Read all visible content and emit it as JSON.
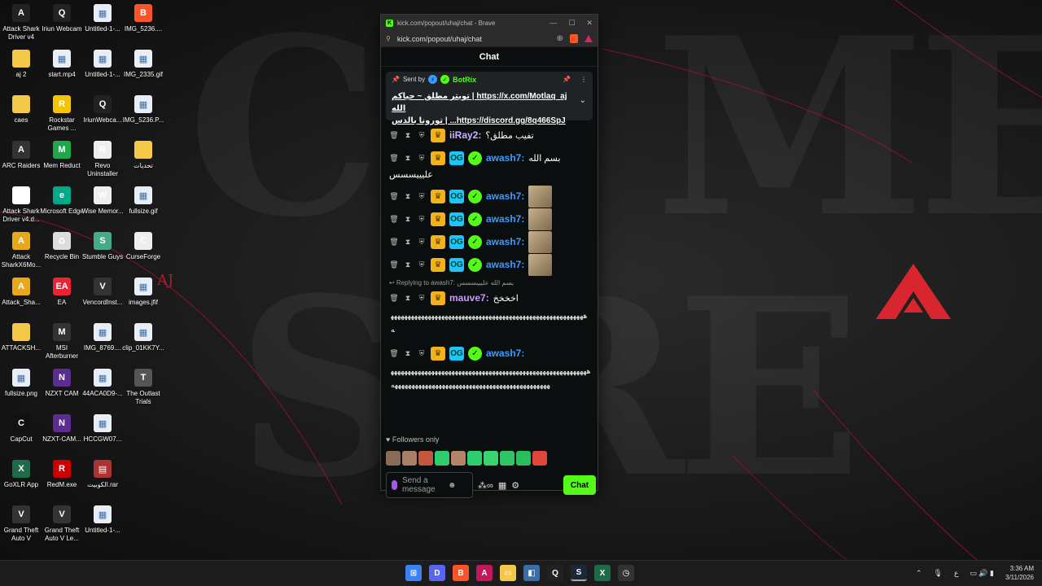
{
  "desktop": {
    "icons": [
      {
        "label": "Attack Shark Driver v4",
        "glyph": "A"
      },
      {
        "label": "Iriun Webcam",
        "glyph": "Q"
      },
      {
        "label": "Untitled-1-...",
        "glyph": "▦"
      },
      {
        "label": "IMG_5236....",
        "glyph": "B"
      },
      {
        "label": "aj 2",
        "glyph": ""
      },
      {
        "label": "start.mp4",
        "glyph": "▦"
      },
      {
        "label": "Untitled-1-...",
        "glyph": "▦"
      },
      {
        "label": "IMG_2335.gif",
        "glyph": "▦"
      },
      {
        "label": "caes",
        "glyph": ""
      },
      {
        "label": "Rockstar Games ...",
        "glyph": "R"
      },
      {
        "label": "IriunWebca...",
        "glyph": "Q"
      },
      {
        "label": "IMG_5236.P...",
        "glyph": "▦"
      },
      {
        "label": "ARC Raiders",
        "glyph": "A"
      },
      {
        "label": "Mem Reduct",
        "glyph": "M"
      },
      {
        "label": "Revo Uninstaller",
        "glyph": "R"
      },
      {
        "label": "تحديات",
        "glyph": ""
      },
      {
        "label": "Attack Shark Driver v4.d...",
        "glyph": "▯"
      },
      {
        "label": "Microsoft Edge",
        "glyph": "e"
      },
      {
        "label": "Wise Memor...",
        "glyph": "W"
      },
      {
        "label": "fullsize.gif",
        "glyph": "▦"
      },
      {
        "label": "Attack SharkX6Mo...",
        "glyph": "A"
      },
      {
        "label": "Recycle Bin",
        "glyph": "♻"
      },
      {
        "label": "Stumble Guys",
        "glyph": "S"
      },
      {
        "label": "CurseForge",
        "glyph": "C"
      },
      {
        "label": "Attack_Sha...",
        "glyph": "A"
      },
      {
        "label": "EA",
        "glyph": "EA"
      },
      {
        "label": "VencordInst...",
        "glyph": "V"
      },
      {
        "label": "images.jfif",
        "glyph": "▦"
      },
      {
        "label": "ATTACKSH...",
        "glyph": ""
      },
      {
        "label": "MSI Afterburner",
        "glyph": "M"
      },
      {
        "label": "IMG_8769....",
        "glyph": "▦"
      },
      {
        "label": "clip_01KK7Y...",
        "glyph": "▦"
      },
      {
        "label": "fullsize.png",
        "glyph": "▦"
      },
      {
        "label": "NZXT CAM",
        "glyph": "N"
      },
      {
        "label": "44ACA0D9-...",
        "glyph": "▦"
      },
      {
        "label": "The Outlast Trials",
        "glyph": "T"
      },
      {
        "label": "CapCut",
        "glyph": "C"
      },
      {
        "label": "NZXT-CAM...",
        "glyph": "N"
      },
      {
        "label": "HCCGW07...",
        "glyph": "▦"
      },
      {
        "label": "",
        "glyph": ""
      },
      {
        "label": "GoXLR App",
        "glyph": "X"
      },
      {
        "label": "RedM.exe",
        "glyph": "R"
      },
      {
        "label": "الكوبيت.rar",
        "glyph": "▤"
      },
      {
        "label": "",
        "glyph": ""
      },
      {
        "label": "Grand Theft Auto V",
        "glyph": "V"
      },
      {
        "label": "Grand Theft Auto V Le...",
        "glyph": "V"
      },
      {
        "label": "Untitled-1-...",
        "glyph": "▦"
      }
    ],
    "wallpaper_text": "AJ"
  },
  "browser": {
    "title": "kick.com/popout/uhaj/chat - Brave",
    "url": "kick.com/popout/uhaj/chat",
    "controls": {
      "minimize": "—",
      "maximize": "☐",
      "close": "✕"
    }
  },
  "chat": {
    "header": "Chat",
    "pinned": {
      "sent_by": "Sent by",
      "bot_name": "BotRix",
      "line1": "https://x.com/Motlaq_aj | تويتر مطلق ~ حياكم الله",
      "line2": "https://discord.gg/8q466SpJ... | تورونا بالدس"
    },
    "messages": [
      {
        "user": "iiRay2:",
        "text": "تفيب مطلق؟",
        "color": "#c9b6ff",
        "badges": [
          "crown"
        ]
      },
      {
        "user": "awash7:",
        "text": "بسم الله",
        "text2": "عليييسسس",
        "color": "#3b9aff",
        "badges": [
          "crown",
          "og",
          "verified"
        ]
      },
      {
        "user": "awash7:",
        "text": "",
        "color": "#3b9aff",
        "badges": [
          "crown",
          "og",
          "verified"
        ],
        "emote": true
      },
      {
        "user": "awash7:",
        "text": "",
        "color": "#3b9aff",
        "badges": [
          "crown",
          "og",
          "verified"
        ],
        "emote": true
      },
      {
        "user": "awash7:",
        "text": "",
        "color": "#3b9aff",
        "badges": [
          "crown",
          "og",
          "verified"
        ],
        "emote": true
      },
      {
        "user": "awash7:",
        "text": "",
        "color": "#3b9aff",
        "badges": [
          "crown",
          "og",
          "verified"
        ],
        "emote": true
      }
    ],
    "reply_to": "Replying to awash7: بسم الله عليييسسس",
    "reply_msg": {
      "user": "mauve7:",
      "text": "اخخخخ",
      "color": "#c89bff"
    },
    "reply_long": "ههههههههههههههههههههههههههههههههههههههههههههههههههههههههههه",
    "last_msg": {
      "user": "awash7:",
      "color": "#3b9aff"
    },
    "last_long": "هههههههههههههههههههههههههههههههههههههههههههههههههههههههههههههههههههههههههههههههههههههههههههههههههههههههههه",
    "followers_only": "Followers only",
    "input_placeholder": "Send a message",
    "chat_button": "Chat"
  },
  "taskbar": {
    "lang": "ع",
    "time": "3:36 AM",
    "date": "3/11/2026"
  },
  "colors": {
    "kick_green": "#53fc18",
    "accent_red": "#e0245e"
  }
}
